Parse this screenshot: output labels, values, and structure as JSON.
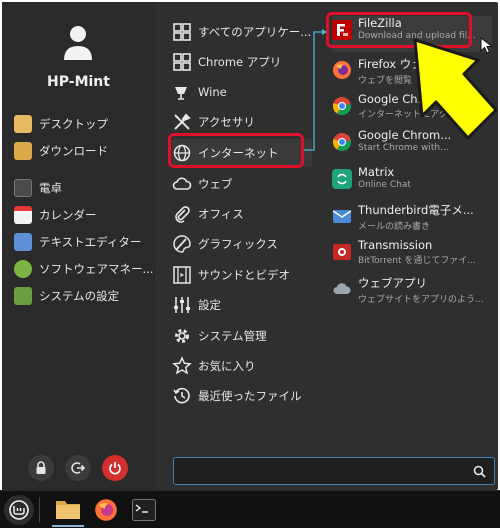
{
  "user": {
    "name": "HP-Mint"
  },
  "favorites": [
    {
      "label": "デスクトップ",
      "icon": "folder-desktop-icon"
    },
    {
      "label": "ダウンロード",
      "icon": "folder-download-icon"
    },
    {
      "label": "電卓",
      "icon": "calculator-icon"
    },
    {
      "label": "カレンダー",
      "icon": "calendar-icon"
    },
    {
      "label": "テキストエディター",
      "icon": "text-editor-icon"
    },
    {
      "label": "ソフトウェアマネー...",
      "icon": "software-manager-icon"
    },
    {
      "label": "システムの設定",
      "icon": "system-settings-icon"
    }
  ],
  "categories": [
    {
      "label": "すべてのアプリケー...",
      "icon": "grid-icon"
    },
    {
      "label": "Chrome アプリ",
      "icon": "grid-icon"
    },
    {
      "label": "Wine",
      "icon": "wine-icon"
    },
    {
      "label": "アクセサリ",
      "icon": "tools-icon"
    },
    {
      "label": "インターネット",
      "icon": "globe-icon"
    },
    {
      "label": "ウェブ",
      "icon": "cloud-icon"
    },
    {
      "label": "オフィス",
      "icon": "paperclip-icon"
    },
    {
      "label": "グラフィックス",
      "icon": "palette-icon"
    },
    {
      "label": "サウンドとビデオ",
      "icon": "media-icon"
    },
    {
      "label": "設定",
      "icon": "sliders-icon"
    },
    {
      "label": "システム管理",
      "icon": "cog-icon"
    },
    {
      "label": "お気に入り",
      "icon": "star-icon"
    },
    {
      "label": "最近使ったファイル",
      "icon": "history-icon"
    }
  ],
  "apps": [
    {
      "name": "FileZilla",
      "desc": "Download and upload fil...",
      "icon": "filezilla-icon"
    },
    {
      "name": "Firefox ウェ...",
      "desc": "ウェブを閲覧",
      "icon": "firefox-icon"
    },
    {
      "name": "Google Ch...",
      "desc": "インターネットにアク...",
      "icon": "chrome-icon"
    },
    {
      "name": "Google Chrom...",
      "desc": "Start Chrome with...",
      "icon": "chrome-icon"
    },
    {
      "name": "Matrix",
      "desc": "Online Chat",
      "icon": "matrix-icon"
    },
    {
      "name": "Thunderbird電子メ...",
      "desc": "メールの読み書き",
      "icon": "thunderbird-icon"
    },
    {
      "name": "Transmission",
      "desc": "BitTorrent を通じてファイ...",
      "icon": "transmission-icon"
    },
    {
      "name": "ウェブアプリ",
      "desc": "ウェブサイトをアプリのよう...",
      "icon": "webapp-icon"
    }
  ],
  "search": {
    "value": ""
  },
  "colors": {
    "highlight": "#e0102a",
    "arrow": "#ffff00",
    "power": "#d32f2f",
    "search_border": "#3e80b8"
  }
}
